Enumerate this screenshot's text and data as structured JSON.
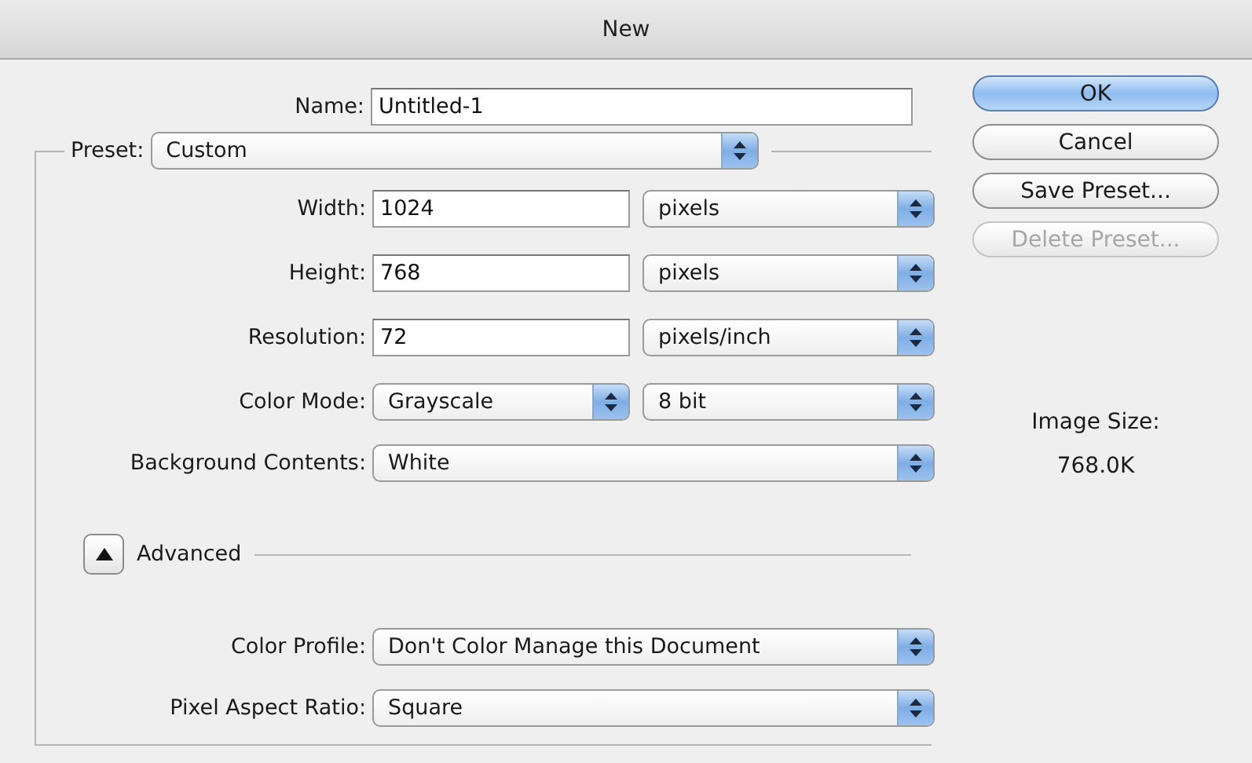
{
  "window": {
    "title": "New"
  },
  "name": {
    "label": "Name:",
    "value": "Untitled-1"
  },
  "preset": {
    "label": "Preset:",
    "value": "Custom"
  },
  "fields": [
    {
      "kind": "text",
      "label": "Width:",
      "value": "1024",
      "unit": "pixels"
    },
    {
      "kind": "text",
      "label": "Height:",
      "value": "768",
      "unit": "pixels"
    },
    {
      "kind": "text",
      "label": "Resolution:",
      "value": "72",
      "unit": "pixels/inch"
    },
    {
      "kind": "popup-pair",
      "label": "Color Mode:",
      "value": "Grayscale",
      "unit": "8 bit"
    },
    {
      "kind": "popup",
      "label": "Background Contents:",
      "value": "White"
    }
  ],
  "advanced": {
    "label": "Advanced",
    "expanded": true,
    "fields": [
      {
        "kind": "popup",
        "label": "Color Profile:",
        "value": "Don't Color Manage this Document"
      },
      {
        "kind": "popup",
        "label": "Pixel Aspect Ratio:",
        "value": "Square"
      }
    ]
  },
  "buttons": [
    {
      "label": "OK",
      "default": true,
      "disabled": false
    },
    {
      "label": "Cancel",
      "default": false,
      "disabled": false
    },
    {
      "label": "Save Preset...",
      "default": false,
      "disabled": false
    },
    {
      "label": "Delete Preset...",
      "default": false,
      "disabled": true
    }
  ],
  "image_size": {
    "label": "Image Size:",
    "value": "768.0K"
  }
}
